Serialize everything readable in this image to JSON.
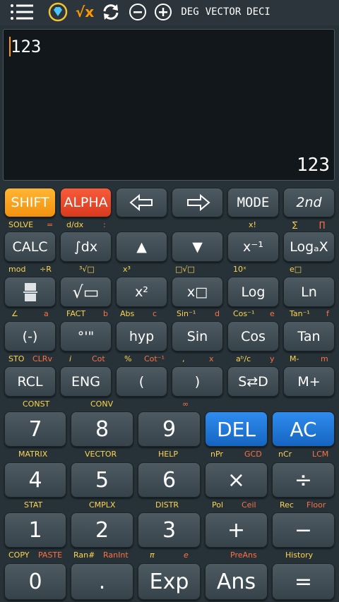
{
  "toolbar": {
    "deg": "DEG",
    "vector": "VECTOR",
    "deci": "DECI"
  },
  "display": {
    "expression": "123",
    "result": "123"
  },
  "row1": {
    "shift": "SHIFT",
    "alpha": "ALPHA",
    "mode": "MODE",
    "second": "2nd"
  },
  "row1_labels": {
    "solve": "SOLVE",
    "eq": "=",
    "ddx": "d/dx",
    "colon": ":",
    "fact": "x!",
    "sigma": "∑",
    "prod": "∏"
  },
  "row2": {
    "calc": "CALC",
    "integral": "∫dx",
    "up": "▲",
    "down": "▼",
    "inverse": "x⁻¹",
    "logax": "LogₐX"
  },
  "row2_labels": {
    "mod": "mod",
    "divr": "÷R",
    "cuberoot": "³√□",
    "cube": "x³",
    "nthroot": "□√□",
    "tenx": "10ˣ",
    "ex": "e□"
  },
  "row3": {
    "frac": "▭",
    "sqrt": "√▭",
    "square": "x²",
    "power": "x□",
    "log": "Log",
    "ln": "Ln"
  },
  "row3_labels": {
    "angle": "∠",
    "a": "a",
    "fact": "FACT",
    "b": "b",
    "abs": "Abs",
    "c": "c",
    "asin": "Sin⁻¹",
    "d": "d",
    "acos": "Cos⁻¹",
    "e": "e",
    "atan": "Tan⁻¹",
    "f": "f"
  },
  "row4": {
    "neg": "(-)",
    "dms": "°'\"",
    "hyp": "hyp",
    "sin": "Sin",
    "cos": "Cos",
    "tan": "Tan"
  },
  "row4_labels": {
    "sto": "STO",
    "clrv": "CLRv",
    "i": "i",
    "cot": "Cot",
    "pct": "%",
    "acot": "Cot⁻¹",
    "comma": ",",
    "x": "x",
    "abc": "aᵇ/c",
    "y": "y",
    "mminus": "M-",
    "m": "m"
  },
  "row5": {
    "rcl": "RCL",
    "eng": "ENG",
    "lparen": "(",
    "rparen": ")",
    "sd": "S⇄D",
    "mplus": "M+"
  },
  "row5_labels": {
    "const": "CONST",
    "conv": "CONV",
    "inf": "∞"
  },
  "row6": {
    "seven": "7",
    "eight": "8",
    "nine": "9",
    "del": "DEL",
    "ac": "AC"
  },
  "row6_labels": {
    "matrix": "MATRIX",
    "vector": "VECTOR",
    "help": "HELP",
    "npr": "nPr",
    "gcd": "GCD",
    "ncr": "nCr",
    "lcm": "LCM"
  },
  "row7": {
    "four": "4",
    "five": "5",
    "six": "6",
    "times": "×",
    "divide": "÷"
  },
  "row7_labels": {
    "stat": "STAT",
    "cmplx": "CMPLX",
    "distr": "DISTR",
    "pol": "Pol",
    "ceil": "Ceil",
    "rec": "Rec",
    "floor": "Floor"
  },
  "row8": {
    "one": "1",
    "two": "2",
    "three": "3",
    "plus": "+",
    "minus": "−"
  },
  "row8_labels": {
    "copy": "COPY",
    "paste": "PASTE",
    "ran": "Ran#",
    "ranint": "RanInt",
    "pi": "π",
    "e": "e",
    "preans": "PreAns",
    "history": "History"
  },
  "row9": {
    "zero": "0",
    "dot": ".",
    "exp": "Exp",
    "ans": "Ans",
    "equals": "="
  },
  "colors": {
    "shift": "#f7a11a",
    "alpha": "#e8492a",
    "blue": "#1e7be0",
    "shift_label": "#ffd54f",
    "alpha_label": "#ff7043"
  }
}
